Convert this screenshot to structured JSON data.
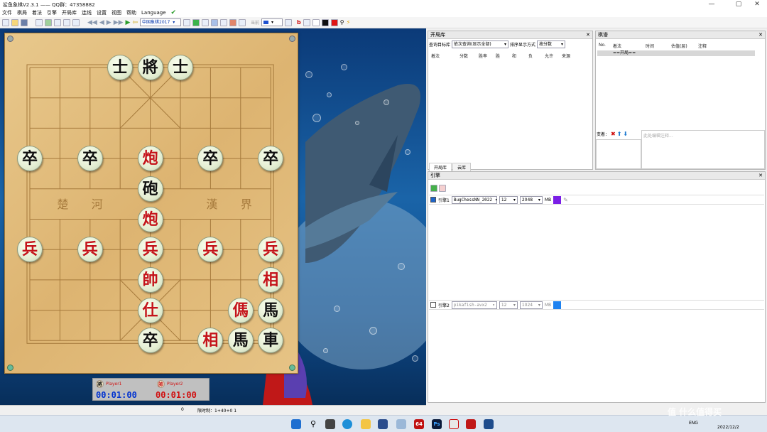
{
  "window": {
    "title": "鲨鱼象棋V2.3.1  —— QQ群：47358882",
    "controls": [
      "—",
      "▢",
      "✕"
    ]
  },
  "menu": [
    "文件",
    "棋局",
    "着法",
    "引擎",
    "开局库",
    "连线",
    "设置",
    "视图",
    "帮助",
    "Language"
  ],
  "toolbar": {
    "opening_select": "中国象棋2017",
    "side_label": "当前"
  },
  "pieces": [
    {
      "ch": "士",
      "side": "black",
      "col": 3,
      "row": 0
    },
    {
      "ch": "將",
      "side": "black",
      "col": 4,
      "row": 0
    },
    {
      "ch": "士",
      "side": "black",
      "col": 5,
      "row": 0
    },
    {
      "ch": "卒",
      "side": "black",
      "col": 0,
      "row": 3
    },
    {
      "ch": "卒",
      "side": "black",
      "col": 2,
      "row": 3
    },
    {
      "ch": "炮",
      "side": "red",
      "col": 4,
      "row": 3
    },
    {
      "ch": "卒",
      "side": "black",
      "col": 6,
      "row": 3
    },
    {
      "ch": "卒",
      "side": "black",
      "col": 8,
      "row": 3
    },
    {
      "ch": "砲",
      "side": "black",
      "col": 4,
      "row": 4
    },
    {
      "ch": "炮",
      "side": "red",
      "col": 4,
      "row": 5
    },
    {
      "ch": "兵",
      "side": "red",
      "col": 0,
      "row": 6
    },
    {
      "ch": "兵",
      "side": "red",
      "col": 2,
      "row": 6
    },
    {
      "ch": "兵",
      "side": "red",
      "col": 4,
      "row": 6
    },
    {
      "ch": "兵",
      "side": "red",
      "col": 6,
      "row": 6
    },
    {
      "ch": "兵",
      "side": "red",
      "col": 8,
      "row": 6
    },
    {
      "ch": "帥",
      "side": "red",
      "col": 4,
      "row": 7
    },
    {
      "ch": "相",
      "side": "red",
      "col": 8,
      "row": 7
    },
    {
      "ch": "仕",
      "side": "red",
      "col": 4,
      "row": 8
    },
    {
      "ch": "傌",
      "side": "red",
      "col": 7,
      "row": 8
    },
    {
      "ch": "馬",
      "side": "black",
      "col": 8,
      "row": 8
    },
    {
      "ch": "卒",
      "side": "black",
      "col": 4,
      "row": 9
    },
    {
      "ch": "相",
      "side": "red",
      "col": 6,
      "row": 9
    },
    {
      "ch": "馬",
      "side": "black",
      "col": 7,
      "row": 9
    },
    {
      "ch": "車",
      "side": "black",
      "col": 8,
      "row": 9
    }
  ],
  "river": [
    "楚",
    "河",
    "漢",
    "界"
  ],
  "players": {
    "p1": {
      "icon": "將",
      "name": "Player1",
      "time": "00:01:00"
    },
    "p2": {
      "icon": "帥",
      "name": "Player2",
      "time": "00:01:00"
    }
  },
  "opening_panel": {
    "title": "开局库",
    "query_label": "查询目标库",
    "query_select": "依次查询(显示全部)",
    "sort_label": "排序显示方式",
    "sort_select": "按分数",
    "columns": [
      "着法",
      "分数",
      "胜率",
      "胜",
      "和",
      "负",
      "允许",
      "来源"
    ],
    "tabs": [
      "开局库",
      "云库"
    ]
  },
  "record_panel": {
    "title": "棋谱",
    "columns": [
      "No.",
      "着法",
      "时间",
      "估值(层)",
      "注释"
    ],
    "first_row": "==开局==",
    "variation_label": "变着：",
    "note_placeholder": "此处编辑注释..."
  },
  "engine_panel": {
    "title": "引擎",
    "engine1": {
      "label": "引擎1",
      "name": "BugChessNN_2022",
      "threads": "12",
      "hash": "2048",
      "unit": "MB",
      "color": "#7a1ee6",
      "checked": true
    },
    "engine2": {
      "label": "引擎2",
      "name": "pikafish-avx2",
      "threads": "12",
      "hash": "1024",
      "unit": "MB",
      "color": "#1e82f0",
      "checked": false
    }
  },
  "status": {
    "count": "0",
    "time_control": "限时制：1+40+0 1"
  },
  "taskbar": {
    "lang": "ENG",
    "date": "2022/12/2",
    "watermark": "值 什么值得买"
  }
}
